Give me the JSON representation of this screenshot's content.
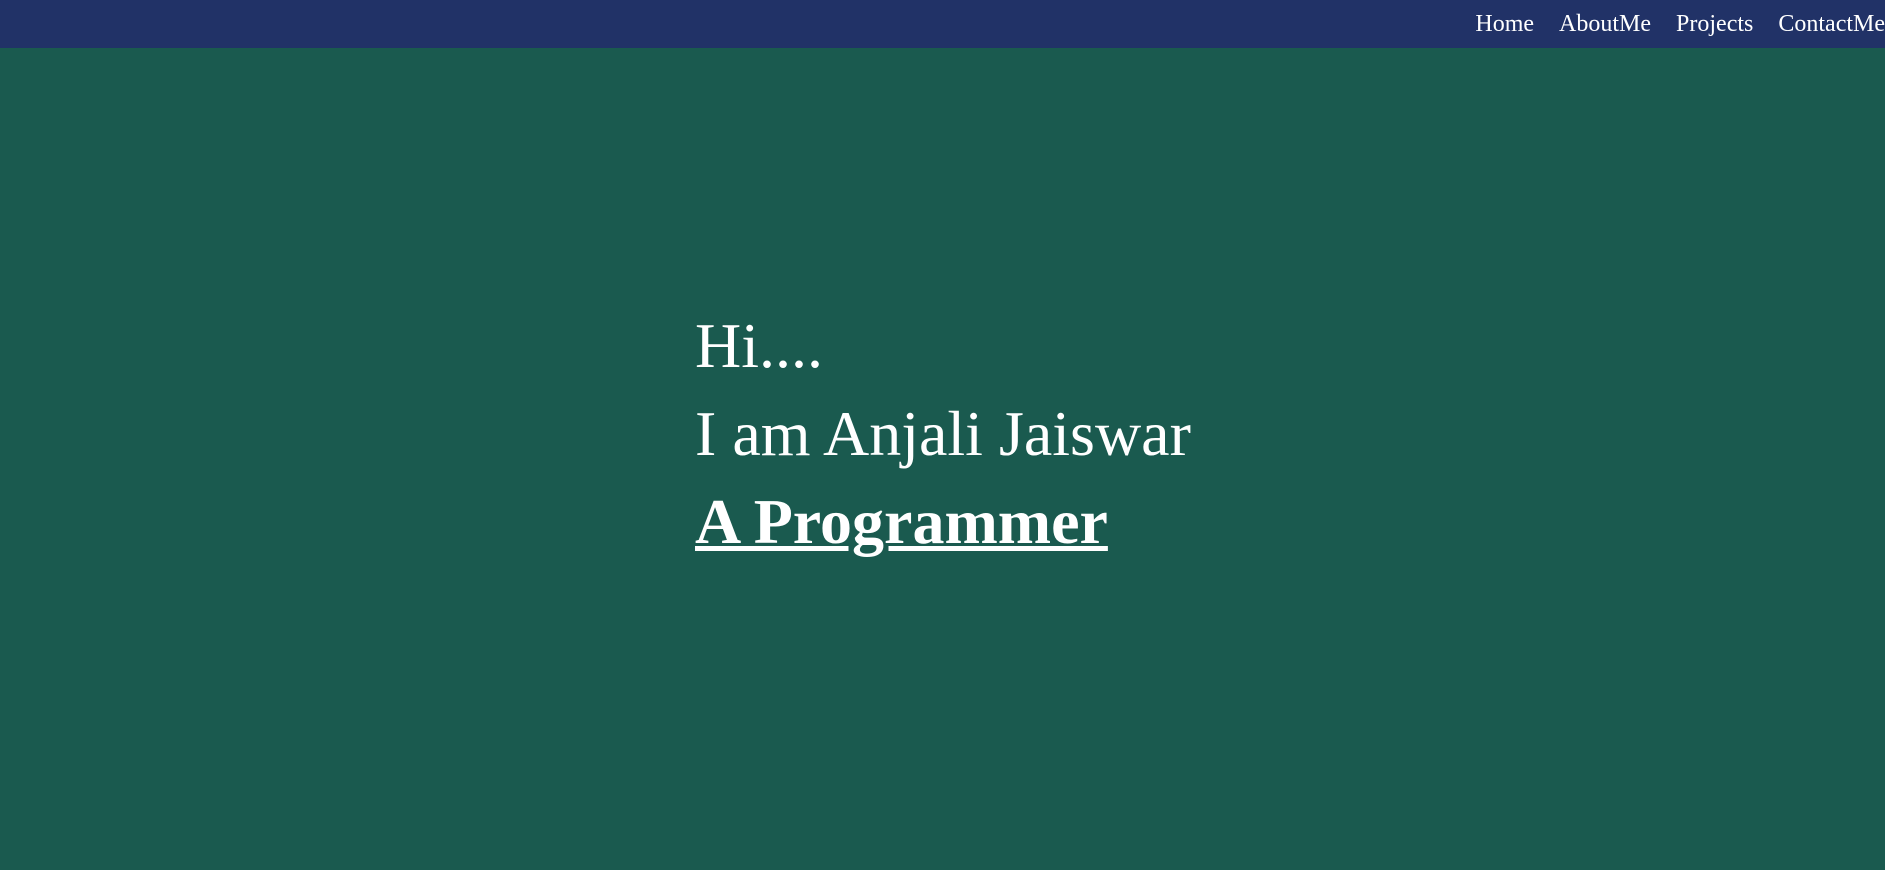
{
  "nav": {
    "items": [
      {
        "label": "Home"
      },
      {
        "label": "AboutMe"
      },
      {
        "label": "Projects"
      },
      {
        "label": "ContactMe"
      }
    ]
  },
  "hero": {
    "greeting": "Hi....",
    "intro": "I am Anjali Jaiswar",
    "role": "A Programmer"
  },
  "colors": {
    "topbar": "#213267",
    "background": "#1a5a4f",
    "text": "#ffffff"
  }
}
